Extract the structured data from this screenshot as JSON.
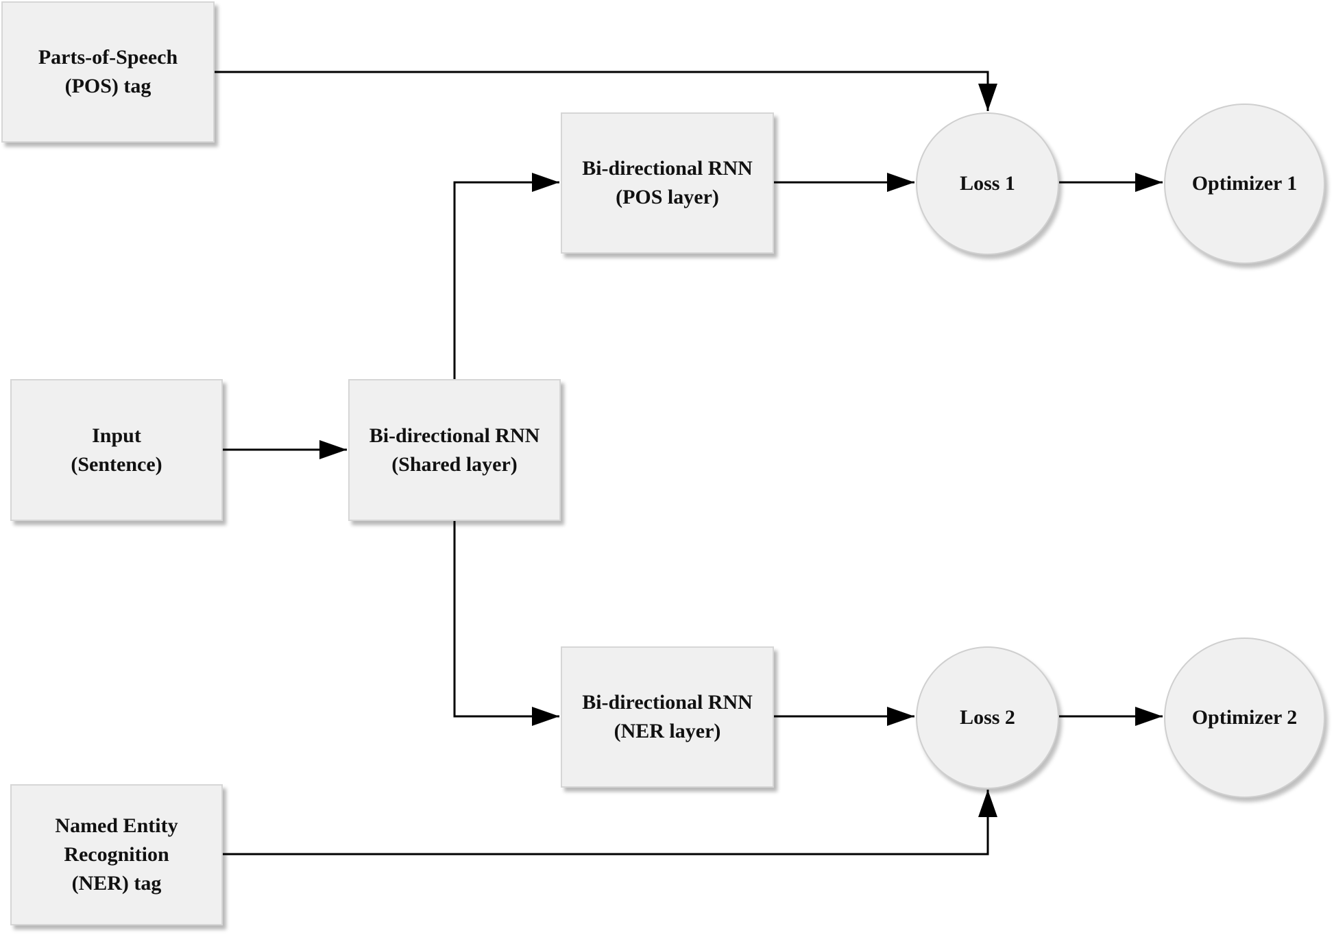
{
  "nodes": {
    "pos_tag": {
      "line1": "Parts-of-Speech",
      "line2": "(POS) tag"
    },
    "input": {
      "line1": "Input",
      "line2": "(Sentence)"
    },
    "shared": {
      "line1": "Bi-directional RNN",
      "line2": "(Shared layer)"
    },
    "pos_layer": {
      "line1": "Bi-directional RNN",
      "line2": "(POS layer)"
    },
    "ner_layer": {
      "line1": "Bi-directional RNN",
      "line2": "(NER layer)"
    },
    "loss1": {
      "label": "Loss 1"
    },
    "loss2": {
      "label": "Loss 2"
    },
    "optimizer1": {
      "label": "Optimizer 1"
    },
    "optimizer2": {
      "label": "Optimizer 2"
    },
    "ner_tag": {
      "line1": "Named Entity",
      "line2": "Recognition",
      "line3": "(NER) tag"
    }
  },
  "edges": [
    {
      "from": "pos_tag",
      "to": "loss1"
    },
    {
      "from": "input",
      "to": "shared"
    },
    {
      "from": "shared",
      "to": "pos_layer"
    },
    {
      "from": "shared",
      "to": "ner_layer"
    },
    {
      "from": "pos_layer",
      "to": "loss1"
    },
    {
      "from": "ner_layer",
      "to": "loss2"
    },
    {
      "from": "loss1",
      "to": "optimizer1"
    },
    {
      "from": "loss2",
      "to": "optimizer2"
    },
    {
      "from": "ner_tag",
      "to": "loss2"
    }
  ]
}
